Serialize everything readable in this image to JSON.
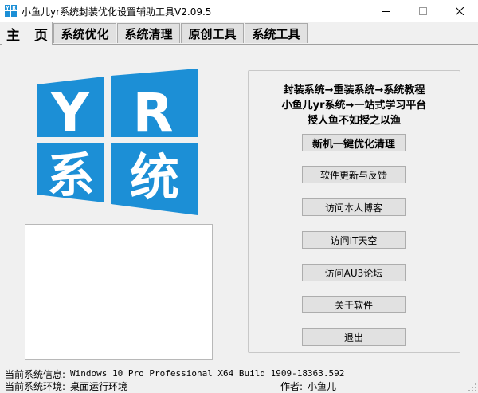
{
  "window": {
    "title": "小鱼儿yr系统封装优化设置辅助工具V2.09.5",
    "icon": "app-icon",
    "controls": [
      "minimize-icon",
      "maximize-icon",
      "close-icon"
    ]
  },
  "tabs": [
    {
      "label": "主 页",
      "active": true
    },
    {
      "label": "系统优化",
      "active": false
    },
    {
      "label": "系统清理",
      "active": false
    },
    {
      "label": "原创工具",
      "active": false
    },
    {
      "label": "系统工具",
      "active": false
    }
  ],
  "logo": {
    "letters": [
      "Y",
      "R",
      "系",
      "统"
    ],
    "tile_color": "#1c8fd6",
    "letter_color": "#ffffff"
  },
  "info": {
    "line1": "封装系统→重装系统→系统教程",
    "line2": "小鱼儿yr系统→一站式学习平台",
    "line3": "授人鱼不如授之以渔"
  },
  "buttons": {
    "optimize": "新机一键优化清理",
    "update": "软件更新与反馈",
    "blog": "访问本人博客",
    "itsky": "访问IT天空",
    "au3": "访问AU3论坛",
    "about": "关于软件",
    "exit": "退出"
  },
  "status": {
    "sysinfo_label": "当前系统信息:",
    "sysinfo_value": "Windows 10 Pro Professional X64 Build 1909-18363.592",
    "env_label": "当前系统环境:",
    "env_value": "桌面运行环境",
    "author_label": "作者:",
    "author_value": "小鱼儿"
  }
}
